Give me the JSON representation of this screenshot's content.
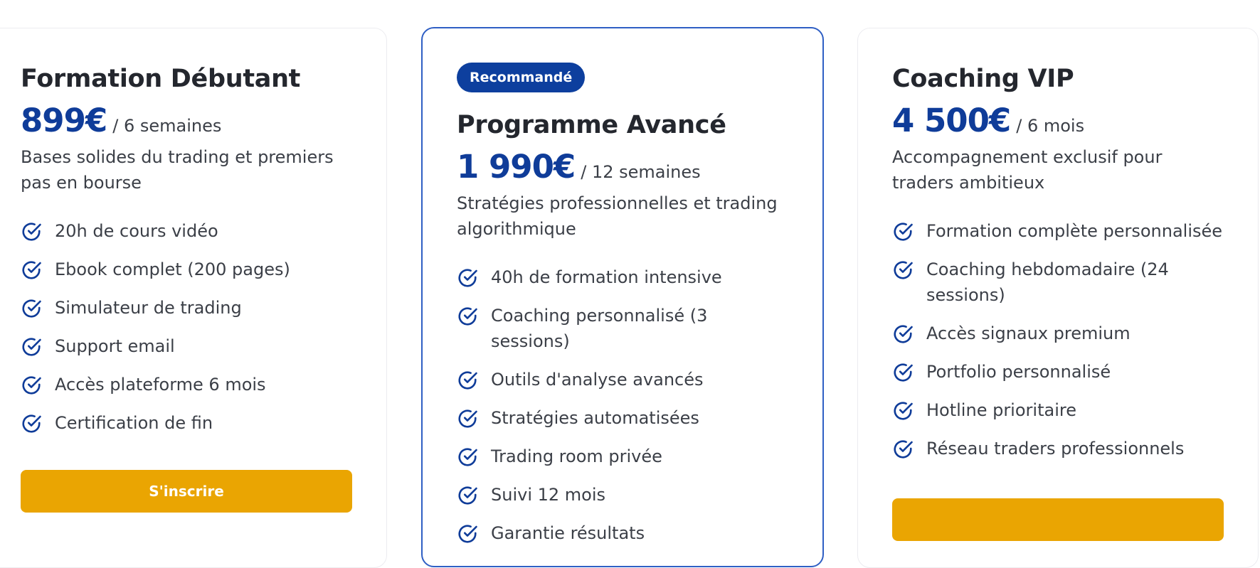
{
  "colors": {
    "accent": "#0f3c99",
    "badge": "#0d3f9e",
    "button": "#eaa502",
    "featured_border": "#2f5fc4"
  },
  "icon": "check-circle-icon",
  "plans": [
    {
      "badge": null,
      "title": "Formation Débutant",
      "price": "899€",
      "period": "/ 6 semaines",
      "description": "Bases solides du trading et premiers pas en bourse",
      "features": [
        "20h de cours vidéo",
        "Ebook complet (200 pages)",
        "Simulateur de trading",
        "Support email",
        "Accès plateforme 6 mois",
        "Certification de fin"
      ],
      "cta": "S'inscrire"
    },
    {
      "badge": "Recommandé",
      "title": "Programme Avancé",
      "price": "1 990€",
      "period": "/ 12 semaines",
      "description": "Stratégies professionnelles et trading algorithmique",
      "features": [
        "40h de formation intensive",
        "Coaching personnalisé (3 sessions)",
        "Outils d'analyse avancés",
        "Stratégies automatisées",
        "Trading room privée",
        "Suivi 12 mois",
        "Garantie résultats"
      ],
      "cta": null
    },
    {
      "badge": null,
      "title": "Coaching VIP",
      "price": "4 500€",
      "period": "/ 6 mois",
      "description": "Accompagnement exclusif pour traders ambitieux",
      "features": [
        "Formation complète personnalisée",
        "Coaching hebdomadaire (24 sessions)",
        "Accès signaux premium",
        "Portfolio personnalisé",
        "Hotline prioritaire",
        "Réseau traders professionnels"
      ],
      "cta": ""
    }
  ]
}
